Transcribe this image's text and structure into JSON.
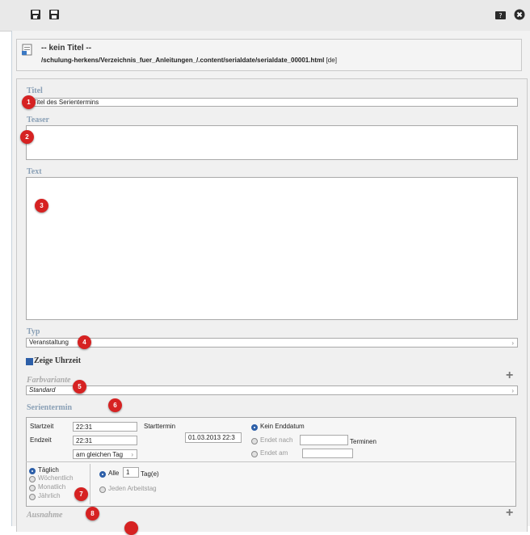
{
  "header": {
    "title": "-- kein Titel --",
    "path": "/schulung-herkens/Verzeichnis_fuer_Anleitungen_/.content/serialdate/serialdate_00001.html",
    "locale": "[de]"
  },
  "fields": {
    "titel_label": "Titel",
    "titel_value": "r Titel des Serientermins",
    "teaser_label": "Teaser",
    "text_label": "Text",
    "typ_label": "Typ",
    "typ_value": "Veranstaltung",
    "show_time_label": "Zeige Uhrzeit",
    "farbvariante_label": "Farbvariante",
    "farbvariante_value": "Standard",
    "serientermin_label": "Serientermin",
    "ausnahme_label": "Ausnahme"
  },
  "serientermin": {
    "startzeit_label": "Startzeit",
    "startzeit_value": "22:31",
    "endzeit_label": "Endzeit",
    "endzeit_value": "22:31",
    "end_select_value": "am gleichen Tag",
    "starttermin_label": "Starttermin",
    "starttermin_value": "01.03.2013 22:3",
    "kein_enddatum": "Kein Enddatum",
    "endet_nach": "Endet nach",
    "terminen": "Terminen",
    "endet_am": "Endet am",
    "taeglich": "Täglich",
    "woechentlich": "Wöchentlich",
    "monatlich": "Monatlich",
    "jaehrlich": "Jährlich",
    "alle": "Alle",
    "alle_value": "1",
    "tage": "Tag(e)",
    "jeden_arbeitstag": "Jeden Arbeitstag"
  },
  "badges": [
    "1",
    "2",
    "3",
    "4",
    "5",
    "6",
    "7",
    "8"
  ],
  "colors": {
    "badge": "#d62222",
    "label": "#8aa0b6",
    "radio_on": "#2d5fa8"
  }
}
